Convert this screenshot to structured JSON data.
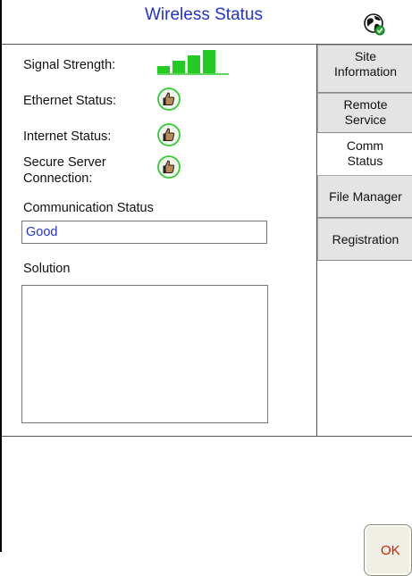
{
  "header": {
    "title": "Wireless Status",
    "status_icon": "globe-connected-icon"
  },
  "status": {
    "signal_label": "Signal Strength:",
    "signal_level": "4 of 4 bars",
    "signal_color": "#22cc22",
    "ethernet_label": "Ethernet Status:",
    "ethernet_icon": "thumbs-up-icon",
    "internet_label": "Internet Status:",
    "internet_icon": "thumbs-up-icon",
    "secure_label_line1": "Secure Server",
    "secure_label_line2": "Connection:",
    "secure_icon": "thumbs-up-icon"
  },
  "communication": {
    "label": "Communication Status",
    "value": "Good",
    "value_color": "#2233cc"
  },
  "solution": {
    "label": "Solution",
    "value": ""
  },
  "sidebar": {
    "tabs": [
      {
        "line1": "Site",
        "line2": "Information"
      },
      {
        "line1": "Remote",
        "line2": "Service"
      },
      {
        "line1": "Comm",
        "line2": "Status"
      },
      {
        "line1": "File Manager",
        "line2": ""
      },
      {
        "line1": "Registration",
        "line2": ""
      }
    ],
    "active_tab": "Comm Status"
  },
  "footer": {
    "ok_label": "OK",
    "ok_color": "#cc2200"
  }
}
